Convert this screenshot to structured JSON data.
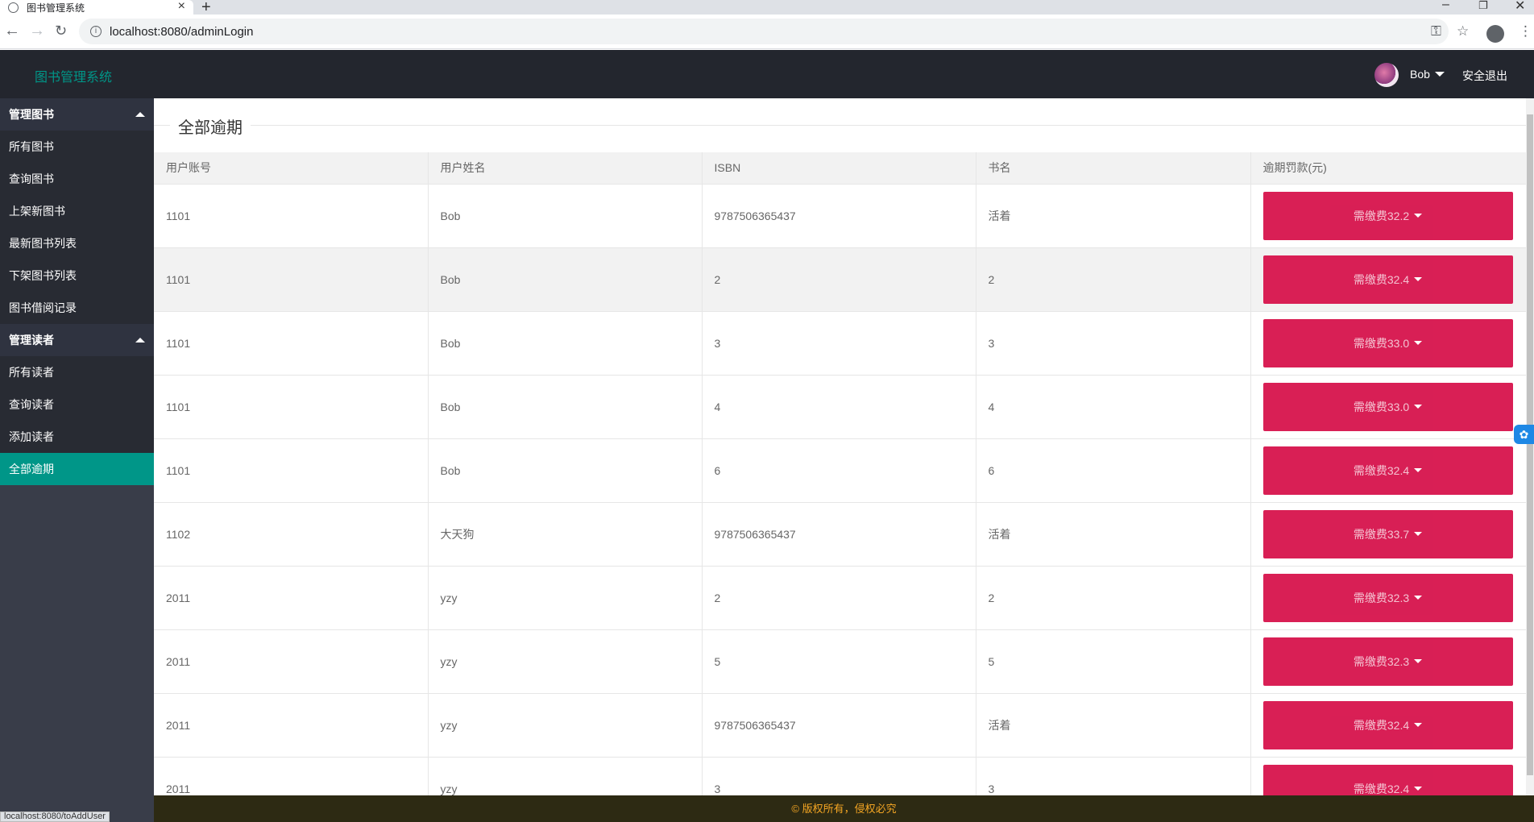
{
  "browser": {
    "tab_title": "图书管理系统",
    "url": "localhost:8080/adminLogin",
    "status_url": "localhost:8080/toAddUser"
  },
  "header": {
    "brand": "图书管理系统",
    "user_name": "Bob",
    "logout": "安全退出"
  },
  "sidebar": {
    "groups": [
      {
        "title": "管理图书",
        "items": [
          "所有图书",
          "查询图书",
          "上架新图书",
          "最新图书列表",
          "下架图书列表",
          "图书借阅记录"
        ]
      },
      {
        "title": "管理读者",
        "items": [
          "所有读者",
          "查询读者",
          "添加读者",
          "全部逾期"
        ]
      }
    ],
    "active_item": "全部逾期"
  },
  "main": {
    "title": "全部逾期",
    "columns": [
      "用户账号",
      "用户姓名",
      "ISBN",
      "书名",
      "逾期罚款(元)"
    ],
    "rows": [
      {
        "account": "1101",
        "name": "Bob",
        "isbn": "9787506365437",
        "book": "活着",
        "fine": "需缴费32.2"
      },
      {
        "account": "1101",
        "name": "Bob",
        "isbn": "2",
        "book": "2",
        "fine": "需缴费32.4"
      },
      {
        "account": "1101",
        "name": "Bob",
        "isbn": "3",
        "book": "3",
        "fine": "需缴费33.0"
      },
      {
        "account": "1101",
        "name": "Bob",
        "isbn": "4",
        "book": "4",
        "fine": "需缴费33.0"
      },
      {
        "account": "1101",
        "name": "Bob",
        "isbn": "6",
        "book": "6",
        "fine": "需缴费32.4"
      },
      {
        "account": "1102",
        "name": "大天狗",
        "isbn": "9787506365437",
        "book": "活着",
        "fine": "需缴费33.7"
      },
      {
        "account": "2011",
        "name": "yzy",
        "isbn": "2",
        "book": "2",
        "fine": "需缴费32.3"
      },
      {
        "account": "2011",
        "name": "yzy",
        "isbn": "5",
        "book": "5",
        "fine": "需缴费32.3"
      },
      {
        "account": "2011",
        "name": "yzy",
        "isbn": "9787506365437",
        "book": "活着",
        "fine": "需缴费32.4"
      },
      {
        "account": "2011",
        "name": "yzy",
        "isbn": "3",
        "book": "3",
        "fine": "需缴费32.4"
      }
    ]
  },
  "footer": {
    "text": "© 版权所有，侵权必究"
  },
  "colors": {
    "accent": "#009688",
    "header_bg": "#23262e",
    "fine_button": "#d81b52",
    "footer_text": "#f5a623"
  }
}
